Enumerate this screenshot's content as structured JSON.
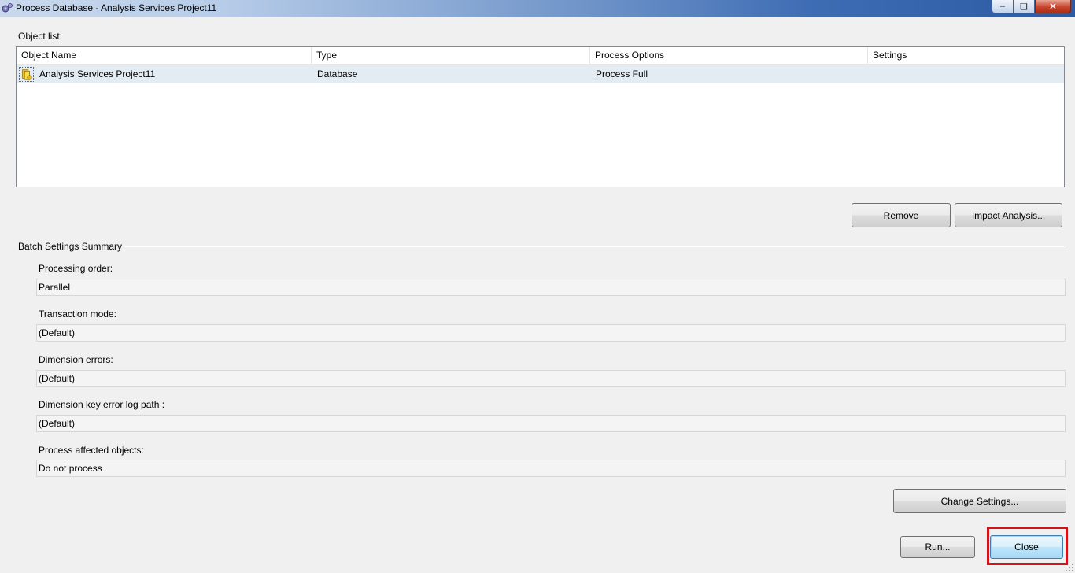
{
  "window": {
    "title": "Process Database - Analysis Services Project11",
    "minimize_symbol": "–",
    "maximize_symbol": "❏",
    "close_symbol": "✕",
    "app_icon": "process-gear-icon"
  },
  "object_list": {
    "label": "Object list:",
    "columns": [
      "Object Name",
      "Type",
      "Process Options",
      "Settings"
    ],
    "rows": [
      {
        "icon": "database-icon",
        "object_name": "Analysis Services Project11",
        "type": "Database",
        "process_options": "Process Full",
        "settings": ""
      }
    ]
  },
  "list_actions": {
    "remove_label": "Remove",
    "impact_analysis_label": "Impact Analysis..."
  },
  "batch_settings": {
    "title": "Batch Settings Summary",
    "fields": [
      {
        "label": "Processing order:",
        "value": "Parallel"
      },
      {
        "label": "Transaction mode:",
        "value": "(Default)"
      },
      {
        "label": "Dimension errors:",
        "value": "(Default)"
      },
      {
        "label": "Dimension key error log path :",
        "value": "(Default)"
      },
      {
        "label": "Process affected objects:",
        "value": "Do not process"
      }
    ],
    "change_settings_label": "Change Settings..."
  },
  "footer": {
    "run_label": "Run...",
    "close_label": "Close"
  },
  "colors": {
    "selected_row": "#e3ebf3",
    "highlight_border": "#d01419",
    "dialog_background": "#f0f0f0"
  }
}
